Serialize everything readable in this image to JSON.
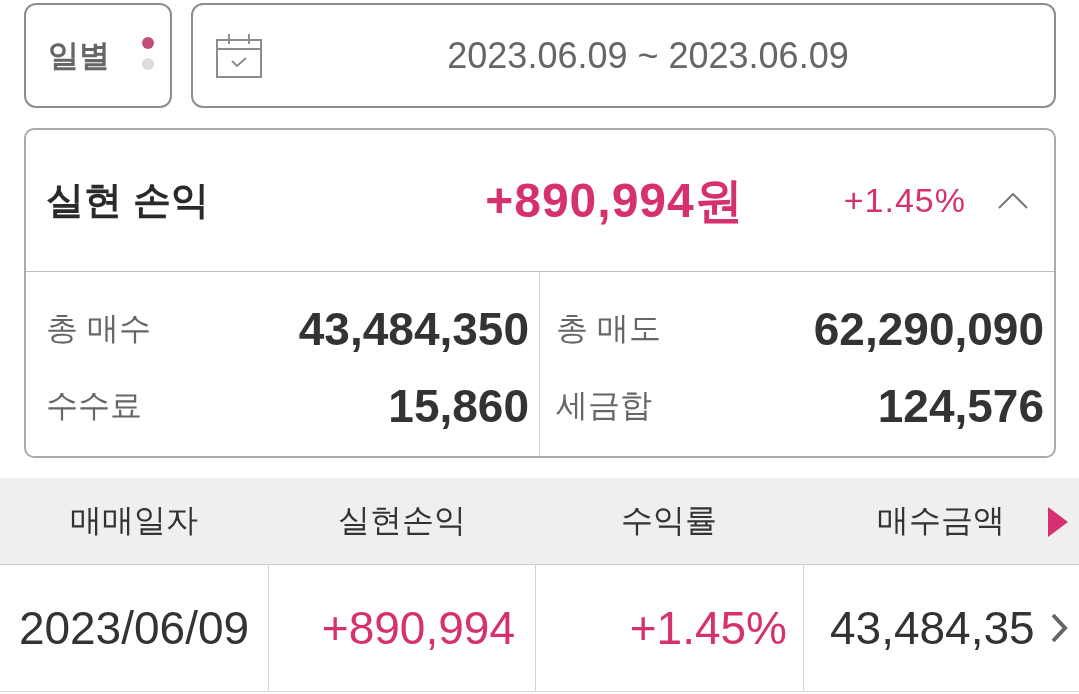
{
  "period_selector": {
    "label": "일별",
    "pages": [
      {
        "selected": true
      },
      {
        "selected": false
      }
    ]
  },
  "date_range": {
    "value": "2023.06.09 ~ 2023.06.09"
  },
  "summary": {
    "title": "실현 손익",
    "amount": "+890,994원",
    "rate": "+1.45%",
    "expanded": true,
    "stats": [
      {
        "label": "총 매수",
        "value": "43,484,350"
      },
      {
        "label": "총 매도",
        "value": "62,290,090"
      },
      {
        "label": "수수료",
        "value": "15,860"
      },
      {
        "label": "세금합",
        "value": "124,576"
      }
    ]
  },
  "table": {
    "columns": [
      {
        "label": "매매일자",
        "kind": "date"
      },
      {
        "label": "실현손익",
        "kind": "profit"
      },
      {
        "label": "수익률",
        "kind": "rate"
      },
      {
        "label": "매수금액",
        "kind": "amount"
      }
    ],
    "rows": [
      {
        "cells": [
          "2023/06/09",
          "+890,994",
          "+1.45%",
          "43,484,35"
        ]
      }
    ]
  }
}
